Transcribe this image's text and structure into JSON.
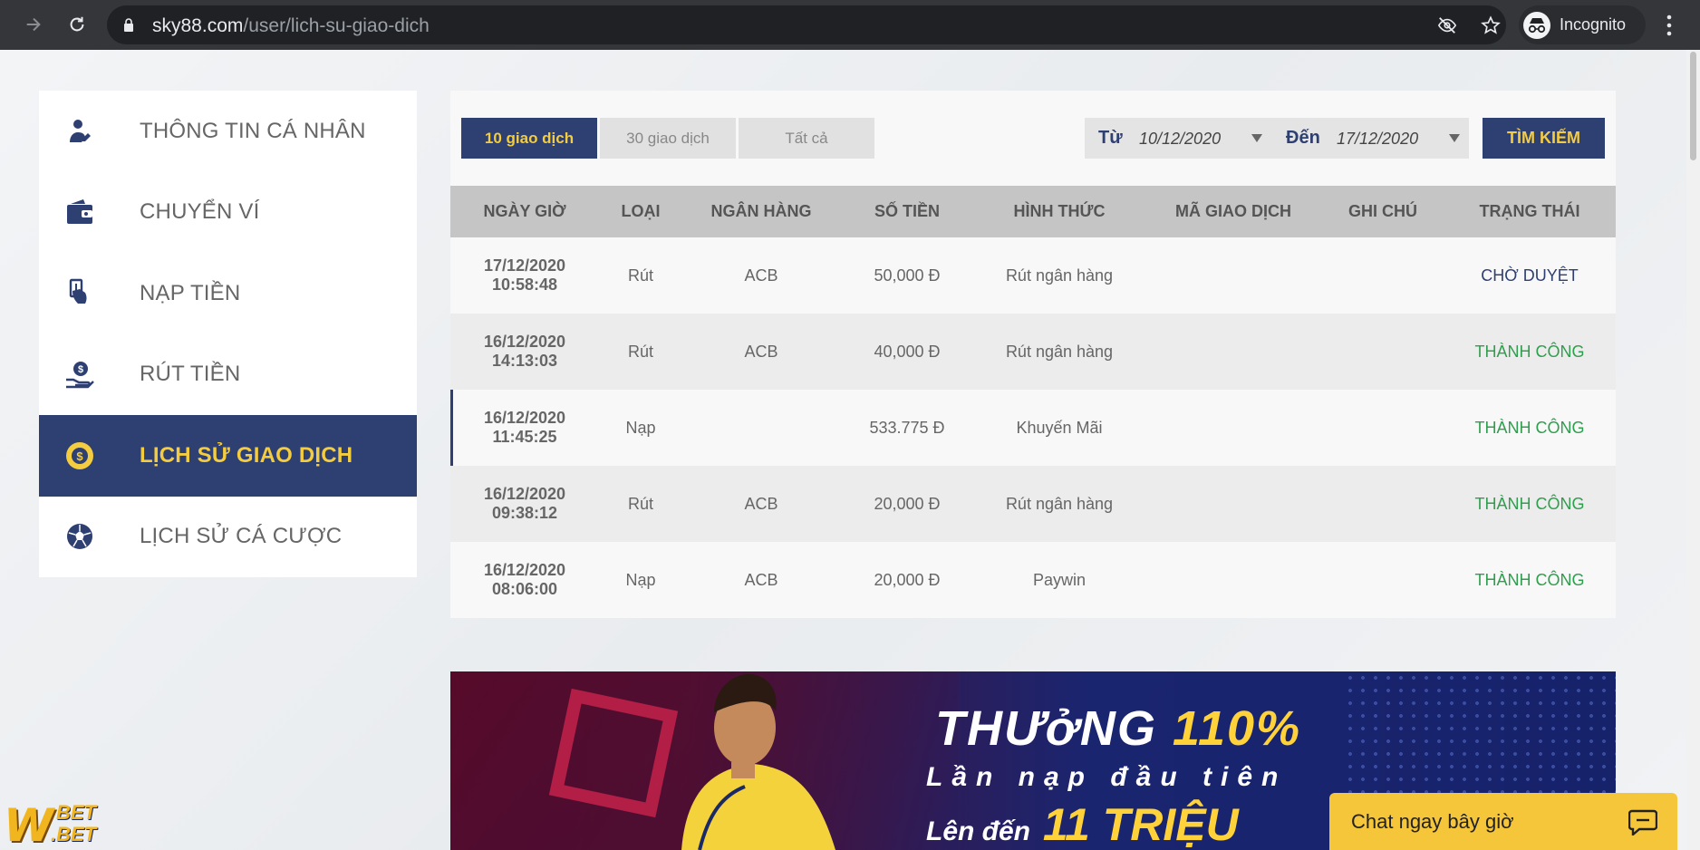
{
  "browser": {
    "url_domain": "sky88.com",
    "url_path": "/user/lich-su-giao-dich",
    "profile_label": "Incognito"
  },
  "sidebar": {
    "items": [
      {
        "label": "THÔNG TIN CÁ NHÂN",
        "icon": "user-icon",
        "active": false
      },
      {
        "label": "CHUYỂN VÍ",
        "icon": "wallet-icon",
        "active": false
      },
      {
        "label": "NẠP TIỀN",
        "icon": "deposit-icon",
        "active": false
      },
      {
        "label": "RÚT TIỀN",
        "icon": "withdraw-icon",
        "active": false
      },
      {
        "label": "LỊCH SỬ GIAO DỊCH",
        "icon": "coin-history-icon",
        "active": true
      },
      {
        "label": "LỊCH SỬ CÁ CƯỢC",
        "icon": "soccer-ball-icon",
        "active": false
      }
    ]
  },
  "filters": {
    "tabs": [
      {
        "label": "10 giao dịch",
        "active": true
      },
      {
        "label": "30 giao dịch",
        "active": false
      },
      {
        "label": "Tất cả",
        "active": false
      }
    ],
    "from_label": "Từ",
    "from_value": "10/12/2020",
    "to_label": "Đến",
    "to_value": "17/12/2020",
    "search_label": "TÌM KIẾM"
  },
  "table": {
    "headers": [
      "NGÀY GIỜ",
      "LOẠI",
      "NGÂN HÀNG",
      "SỐ TIỀN",
      "HÌNH THỨC",
      "MÃ GIAO DỊCH",
      "GHI CHÚ",
      "TRẠNG THÁI"
    ],
    "rows": [
      {
        "date": "17/12/2020",
        "time": "10:58:48",
        "type": "Rút",
        "bank": "ACB",
        "amount": "50,000 Đ",
        "method": "Rút ngân hàng",
        "code": "",
        "note": "",
        "status": "CHỜ DUYỆT",
        "status_kind": "pending"
      },
      {
        "date": "16/12/2020",
        "time": "14:13:03",
        "type": "Rút",
        "bank": "ACB",
        "amount": "40,000 Đ",
        "method": "Rút ngân hàng",
        "code": "",
        "note": "",
        "status": "THÀNH CÔNG",
        "status_kind": "ok"
      },
      {
        "date": "16/12/2020",
        "time": "11:45:25",
        "type": "Nạp",
        "bank": "",
        "amount": "533.775 Đ",
        "method": "Khuyến Mãi",
        "code": "",
        "note": "",
        "status": "THÀNH CÔNG",
        "status_kind": "ok"
      },
      {
        "date": "16/12/2020",
        "time": "09:38:12",
        "type": "Rút",
        "bank": "ACB",
        "amount": "20,000 Đ",
        "method": "Rút ngân hàng",
        "code": "",
        "note": "",
        "status": "THÀNH CÔNG",
        "status_kind": "ok"
      },
      {
        "date": "16/12/2020",
        "time": "08:06:00",
        "type": "Nạp",
        "bank": "ACB",
        "amount": "20,000 Đ",
        "method": "Paywin",
        "code": "",
        "note": "",
        "status": "THÀNH CÔNG",
        "status_kind": "ok"
      }
    ]
  },
  "banner": {
    "line1_prefix": "THƯởNG",
    "line1_highlight": "110%",
    "line2": "Lần nạp đầu tiên",
    "line3_prefix": "Lên đến",
    "line3_highlight": "11 TRIỆU"
  },
  "chat": {
    "label": "Chat ngay bây giờ"
  },
  "logo": {
    "mark": "W",
    "text1": "BET",
    "text2": ".BET"
  },
  "colors": {
    "brand_navy": "#2e3f72",
    "brand_gold": "#f4cc3f",
    "success_green": "#2f9e4e"
  }
}
